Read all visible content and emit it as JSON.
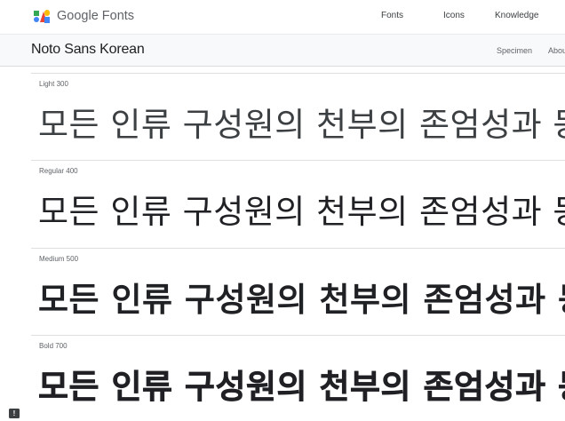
{
  "header": {
    "brand": "Google Fonts",
    "nav": [
      "Fonts",
      "Icons",
      "Knowledge"
    ]
  },
  "family": {
    "name": "Noto Sans Korean",
    "tabs": [
      "Specimen",
      "About"
    ]
  },
  "styles": [
    {
      "label": "Light 300",
      "sample": "모든 인류 구성원의 천부의 존엄성과 동"
    },
    {
      "label": "Regular 400",
      "sample": "모든 인류 구성원의 천부의 존엄성과 동"
    },
    {
      "label": "Medium 500",
      "sample": "모든 인류 구성원의 천부의 존엄성과 동"
    },
    {
      "label": "Bold 700",
      "sample": "모든 인류 구성원의 천부의 존엄성과 동"
    }
  ],
  "feedback_icon": "feedback-icon",
  "logo_colors": [
    "#4285f4",
    "#ea4335",
    "#fbbc04",
    "#34a853"
  ]
}
